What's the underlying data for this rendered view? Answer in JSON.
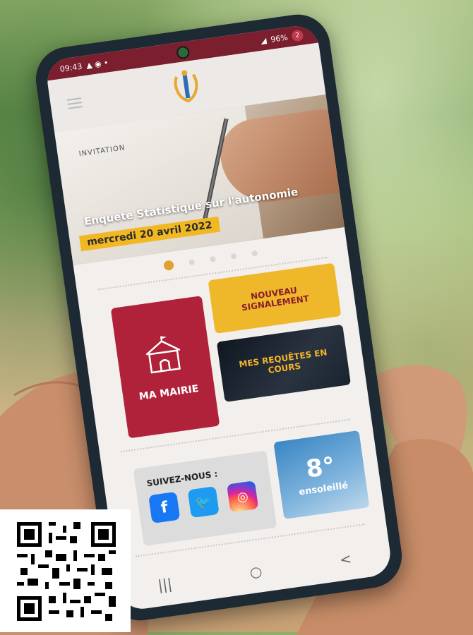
{
  "status_bar": {
    "left": "09:43",
    "right": "96%",
    "badge": "2"
  },
  "banner": {
    "small_text": "INVITATION",
    "title": "Enquete Statistique sur l'autonomie",
    "date": "mercredi 20 avril 2022"
  },
  "carousel": {
    "dots": 5,
    "active": 1
  },
  "tiles": {
    "mairie": "MA MAIRIE",
    "signalement": "NOUVEAU SIGNALEMENT",
    "requetes": "MES REQUÊTES EN COURS",
    "social_title": "SUIVEZ-NOUS :",
    "temperature": "8°",
    "weather": "ensoleillé"
  },
  "social": [
    "facebook-icon",
    "twitter-icon",
    "instagram-icon"
  ],
  "nav": {
    "recent": "|||",
    "home": "○",
    "back": "<"
  },
  "colors": {
    "primary": "#b0223a",
    "accent": "#efb82a",
    "status": "#7b1e2e"
  }
}
